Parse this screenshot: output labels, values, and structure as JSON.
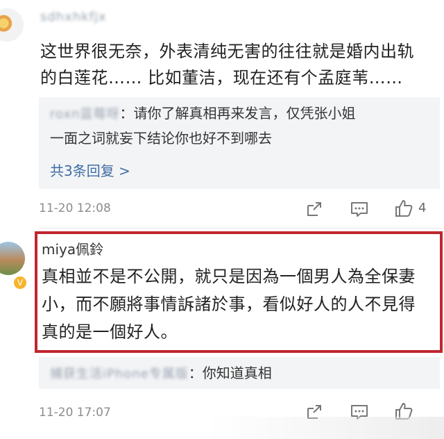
{
  "comment1": {
    "username": "sdhxhkfjx",
    "text_line1": "这世界很无奈，外表清纯无害的往往就是婚内出轨",
    "text_line2": "的白莲花…… 比如董洁，现在还有个孟庭苇……",
    "reply": {
      "author": "roxn蓝莓呀",
      "text_line1": "：请你了解真相再来发言，仅凭张小姐",
      "text_line2": "一面之词就妄下结论你也好不到哪去"
    },
    "more_replies": "共3条回复 >",
    "time": "11-20 12:08",
    "like_count": "4"
  },
  "comment2": {
    "username": "miya佩鈴",
    "text_line1": "真相並不是不公開，就只是因為一個男人為全保妻",
    "text_line2": "小，而不願將事情訴諸於事，看似好人的人不見得",
    "text_line3": "真的是一個好人。",
    "reply": {
      "author": "捕获生活iPhone专属版",
      "text": "：你知道真相"
    },
    "time": "11-20 17:07",
    "like_count": ""
  },
  "icons": {
    "share": "share-icon",
    "comment": "comment-icon",
    "like": "thumbs-up-icon"
  },
  "colors": {
    "highlight": "#c0262e",
    "link": "#3d6da3"
  }
}
